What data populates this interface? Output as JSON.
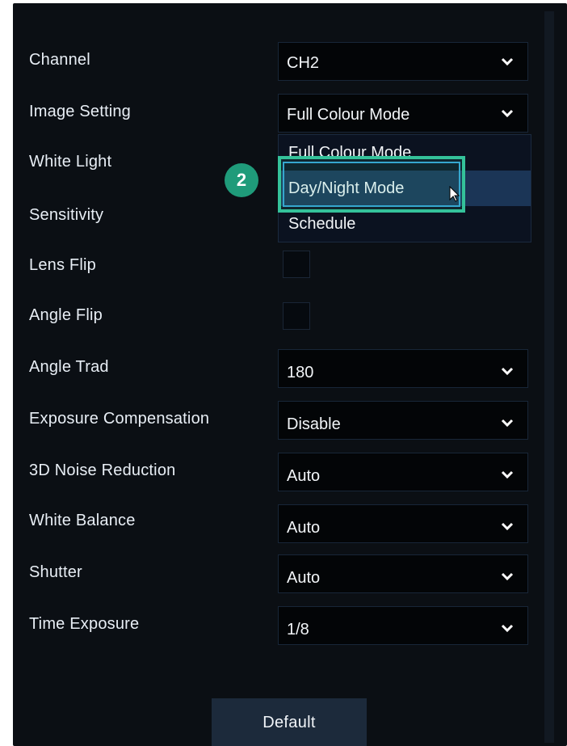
{
  "settings": {
    "channel": {
      "label": "Channel",
      "value": "CH2"
    },
    "image_setting": {
      "label": "Image Setting",
      "value": "Full Colour Mode"
    },
    "white_light": {
      "label": "White Light"
    },
    "sensitivity": {
      "label": "Sensitivity"
    },
    "lens_flip": {
      "label": "Lens Flip",
      "checked": false
    },
    "angle_flip": {
      "label": "Angle Flip",
      "checked": false
    },
    "angle_trad": {
      "label": "Angle Trad",
      "value": "180"
    },
    "exposure_compensation": {
      "label": "Exposure Compensation",
      "value": "Disable"
    },
    "noise_reduction": {
      "label": "3D Noise Reduction",
      "value": "Auto"
    },
    "white_balance": {
      "label": "White Balance",
      "value": "Auto"
    },
    "shutter": {
      "label": "Shutter",
      "value": "Auto"
    },
    "time_exposure": {
      "label": "Time Exposure",
      "value": "1/8"
    }
  },
  "dropdown": {
    "options": [
      "Full Colour Mode",
      "Day/Night Mode",
      "Schedule"
    ],
    "hovered_option": "Day/Night Mode"
  },
  "annotation": {
    "step_number": "2"
  },
  "buttons": {
    "default_label": "Default"
  },
  "icons": {
    "chevron": "chevron-down-icon",
    "cursor": "mouse-pointer-icon"
  },
  "colors": {
    "panel_background": "#0b0f14",
    "select_background": "#030507",
    "highlight_border": "#34c29a",
    "hovered_option_background": "#1b3556",
    "step_badge": "#1f9b7a",
    "button_background": "#1c2a3b"
  }
}
